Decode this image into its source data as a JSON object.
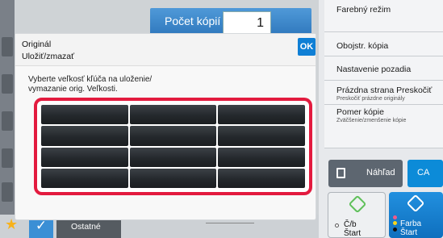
{
  "header": {
    "copies_label": "Počet kópií",
    "copies_value": "1"
  },
  "dialog": {
    "title_line1": "Originál",
    "title_line2": "Uložiť/zmazať",
    "ok_label": "OK",
    "instruction_line1": "Vyberte veľkosť kľúča na uloženie/",
    "instruction_line2": "vymazanie orig. Veľkosti.",
    "grid_rows": 4,
    "grid_cols": 3
  },
  "right_menu": {
    "items": [
      {
        "label": "Farebný režim",
        "sub": ""
      },
      {
        "label": "Obojstr. kópia",
        "sub": ""
      },
      {
        "label": "Nastavenie pozadia",
        "sub": ""
      },
      {
        "label": "Prázdna strana Preskočiť",
        "sub": "Preskočiť prázdne originály"
      },
      {
        "label": "Pomer kópie",
        "sub": "Zväčšenie/zmenšenie kópie"
      }
    ]
  },
  "actions": {
    "preview_label": "Náhľad",
    "ca_label": "CA",
    "bw_line1": "Č/b",
    "bw_line2": "Štart",
    "color_line1": "Farba",
    "color_line2": "Štart"
  },
  "bottom": {
    "others_label": "Ostatné"
  },
  "colors": {
    "accent_blue": "#0f7fd5",
    "highlight_red": "#e31b3f",
    "key_dark": "#24282c"
  },
  "icons": [
    "arrow-right-icon",
    "preview-icon",
    "diamond-start-icon",
    "star-icon",
    "check-icon"
  ]
}
